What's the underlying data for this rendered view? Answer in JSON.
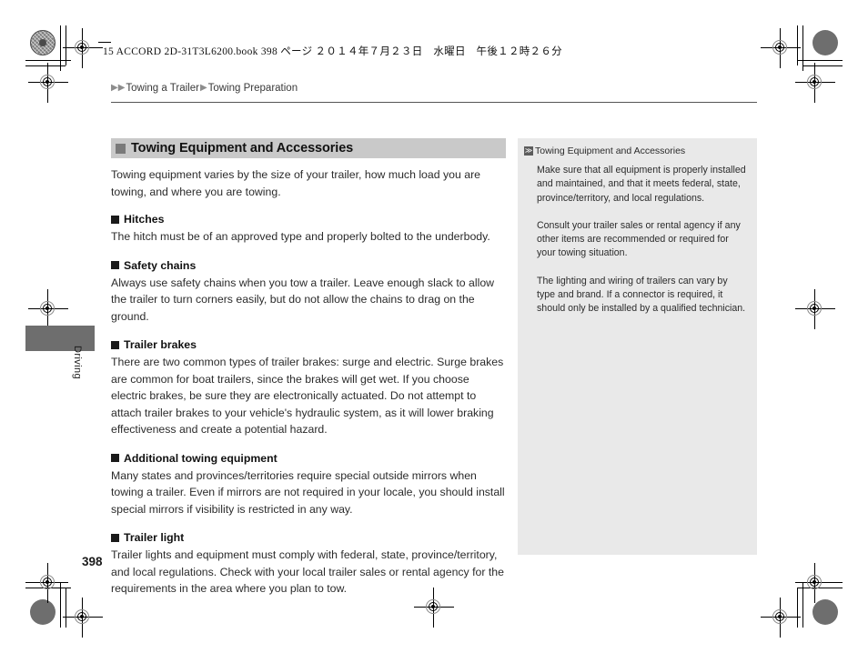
{
  "print_marks": {
    "file_header": "15 ACCORD 2D-31T3L6200.book  398 ページ  ２０１４年７月２３日　水曜日　午後１２時２６分"
  },
  "breadcrumb": {
    "arrow_double": "▶▶",
    "arrow_single": "▶",
    "level1": "Towing a Trailer",
    "level2": "Towing Preparation"
  },
  "main": {
    "section_title": "Towing Equipment and Accessories",
    "intro": "Towing equipment varies by the size of your trailer, how much load you are towing, and where you are towing.",
    "subsections": [
      {
        "heading": "Hitches",
        "body": "The hitch must be of an approved type and properly bolted to the underbody."
      },
      {
        "heading": "Safety chains",
        "body": "Always use safety chains when you tow a trailer. Leave enough slack to allow the trailer to turn corners easily, but do not allow the chains to drag on the ground."
      },
      {
        "heading": "Trailer brakes",
        "body": "There are two common types of trailer brakes: surge and electric. Surge brakes are common for boat trailers, since the brakes will get wet. If you choose electric brakes, be sure they are electronically actuated. Do not attempt to attach trailer brakes to your vehicle's hydraulic system, as it will lower braking effectiveness and create a potential hazard."
      },
      {
        "heading": "Additional towing equipment",
        "body": "Many states and provinces/territories require special outside mirrors when towing a trailer. Even if mirrors are not required in your locale, you should install special mirrors if visibility is restricted in any way."
      },
      {
        "heading": "Trailer light",
        "body": "Trailer lights and equipment must comply with federal, state, province/territory, and local regulations. Check with your local trailer sales or rental agency for the requirements in the area where you plan to tow."
      }
    ]
  },
  "info_panel": {
    "marker": "≫",
    "title": "Towing Equipment and Accessories",
    "paragraphs": [
      "Make sure that all equipment is properly installed and maintained, and that it meets federal, state, province/territory, and local regulations.",
      "Consult your trailer sales or rental agency if any other items are recommended or required for your towing situation.",
      "The lighting and wiring of trailers can vary by type and brand. If a connector is required, it should only be installed by a qualified technician."
    ]
  },
  "thumb_tab": {
    "label": "Driving"
  },
  "footer": {
    "page_number": "398"
  },
  "colors": {
    "section_bar": "#c9c9c9",
    "info_panel_bg": "#e9e9e9",
    "thumb_tab": "#6e6e6e",
    "text": "#2b2b2b"
  }
}
